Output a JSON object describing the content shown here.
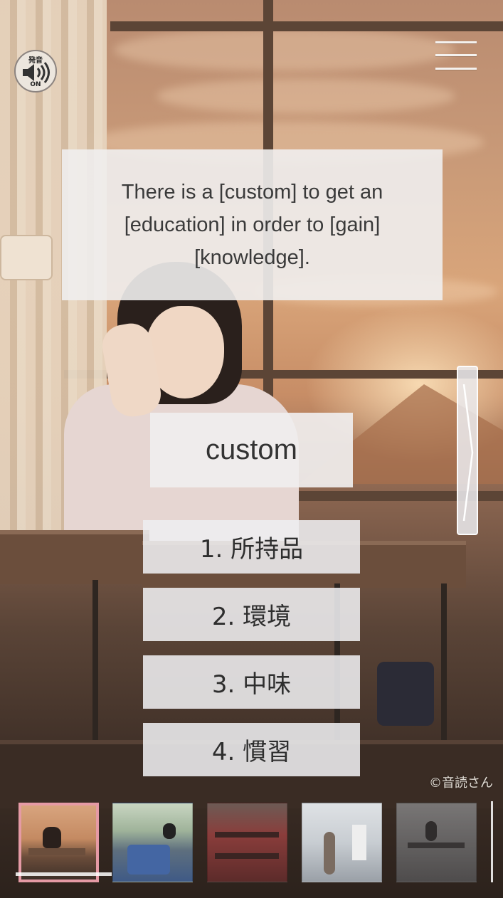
{
  "sound": {
    "top_label": "発音",
    "bottom_label": "ON",
    "icon": "speaker-icon"
  },
  "menu": {
    "icon": "hamburger-menu-icon"
  },
  "sentence": "There is a [custom] to get an [education] in order to [gain] [knowledge].",
  "word": "custom",
  "choices": [
    {
      "label": "1. 所持品"
    },
    {
      "label": "2. 環境"
    },
    {
      "label": "3. 中味"
    },
    {
      "label": "4. 慣習"
    }
  ],
  "side_tab": {
    "icon": "chevron-right-icon"
  },
  "copyright": "©音読さん",
  "thumbnails": [
    {
      "name": "classroom-sunset",
      "selected": true
    },
    {
      "name": "bus-seat"
    },
    {
      "name": "auditorium"
    },
    {
      "name": "clothing-store"
    },
    {
      "name": "cafe-table"
    }
  ],
  "colors": {
    "accent_selected": "#e59aa5",
    "panel": "#f0eeee",
    "text": "#333333"
  }
}
